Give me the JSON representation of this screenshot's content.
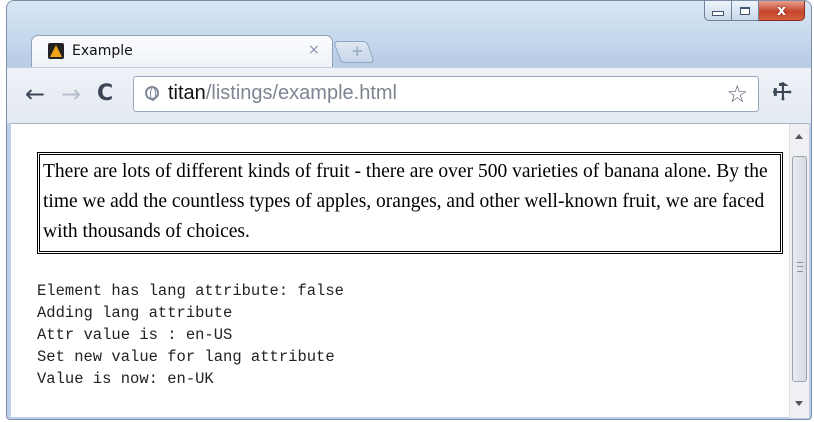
{
  "window": {
    "controls": {
      "minimize": "minimize",
      "maximize": "maximize",
      "close": "x"
    }
  },
  "tab": {
    "title": "Example",
    "close_glyph": "×",
    "new_tab_glyph": "+"
  },
  "toolbar": {
    "back_glyph": "←",
    "forward_glyph": "→",
    "reload_glyph": "C",
    "url_host": "titan",
    "url_path": "/listings/example.html",
    "star_glyph": "☆",
    "wrench_glyph": "🔧"
  },
  "content": {
    "paragraph": "There are lots of different kinds of fruit - there are over 500 varieties of banana alone. By the time we add the countless types of apples, oranges, and other well-known fruit, we are faced with thousands of choices.",
    "output_lines": [
      "Element has lang attribute: false",
      "Adding lang attribute",
      "Attr value is : en-US",
      "Set new value for lang attribute",
      "Value is now: en-UK"
    ]
  },
  "icons": {
    "favicon": "favicon-icon",
    "security": "globe-icon",
    "bookmark": "star-icon",
    "settings": "wrench-icon"
  }
}
